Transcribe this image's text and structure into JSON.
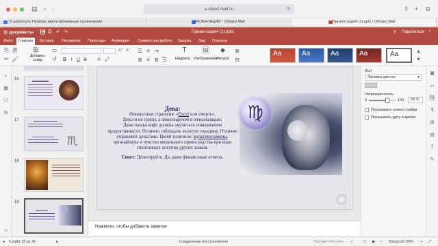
{
  "browser": {
    "address": "cloud.mail.ru",
    "tabs": [
      {
        "label": "В аэропорту Пулково ввели временные ограничения"
      },
      {
        "label": "ПРЕЗЕНТАЦИИ / Облако Mail"
      },
      {
        "label": "Презентация4 (1).pptx / Облако Mail"
      }
    ]
  },
  "app": {
    "logo": "@ документы",
    "doc_title": "Презентация4 (1).pptx",
    "share_label": "Поделиться",
    "menu": [
      "Файл",
      "Главная",
      "Вставка",
      "Рисование",
      "Переходы",
      "Анимация",
      "Совместная работа",
      "Защита",
      "Вид",
      "Плагины"
    ],
    "active_menu": "Главная",
    "toolbar": {
      "add_slide_label": "Добавить слайд",
      "text_label": "Надпись",
      "image_label": "Изображение",
      "shape_label": "Фигура",
      "theme_sample": "Aa"
    }
  },
  "thumbnails": [
    {
      "num": "16"
    },
    {
      "num": "17"
    },
    {
      "num": "18"
    },
    {
      "num": "19"
    }
  ],
  "slide": {
    "title": "Дева:",
    "line1_pre": "Финансовая стратегия: «",
    "line1_link": "Excel",
    "line1_post": " или смерть».",
    "line2_pre": "Деньги не тратят, а ",
    "line2_em": "инвестируют в оптимизацию",
    "line2_post": ".",
    "line3": "Даже чашка кофе должна окупиться повышением продуктивности. Отлично соблюдать золотую середину. Отлично управляют деньгами. Ценят полезное: ",
    "line3_link": "мультивитамины",
    "line3_post": ", органайзеры и чувство морального превосходства при виде спонтанных покупок других знаков.",
    "advice_label": "Совет:",
    "advice_text": " Делегируйте. Да, даже финансовые отчеты.",
    "zodiac_symbol": "♍"
  },
  "notes_placeholder": "Нажмите, чтобы добавить заметки",
  "right_panel": {
    "fill_heading": "Фон",
    "fill_value": "Заливка цветом",
    "opacity_heading": "Непрозрачность",
    "opacity_min": "0",
    "opacity_max": "100",
    "opacity_value": "68 %",
    "opacity_fraction": 0.68,
    "show_slide_number": "Показывать номер слайда",
    "show_date": "Показывать дату и время"
  },
  "status": {
    "slide_counter": "Слайд 19 из 36",
    "connection": "Соединение восстановлено",
    "language": "Русский (Россия)",
    "zoom": "Масштаб 65%"
  },
  "colors": {
    "brand": "#b44b40",
    "slide_text": "#2c1a5c"
  }
}
